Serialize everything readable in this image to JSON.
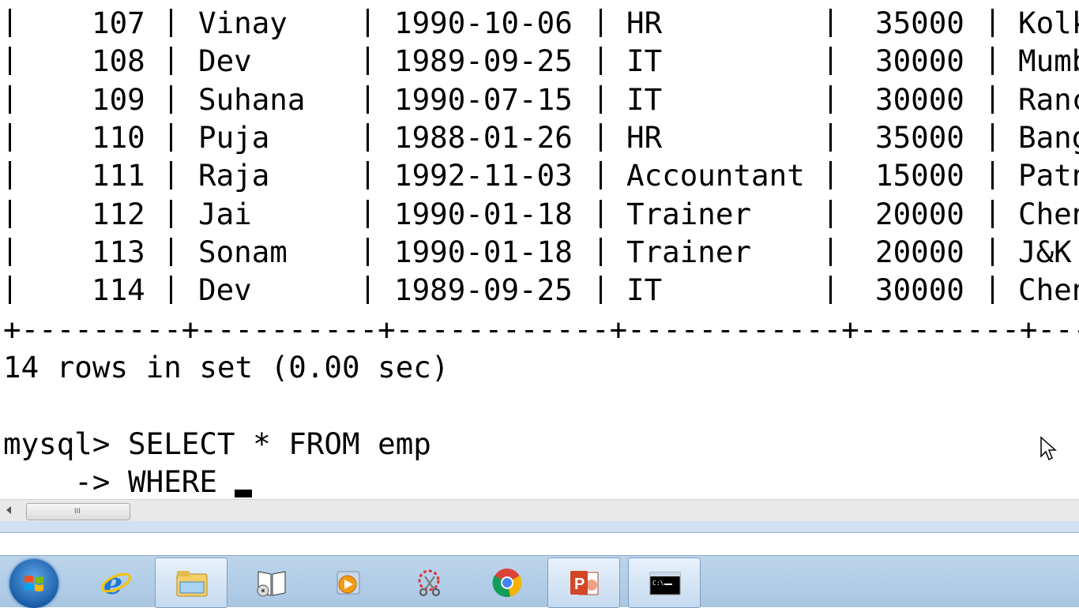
{
  "terminal": {
    "rows": [
      {
        "id": "107",
        "name": "Vinay",
        "dob": "1990-10-06",
        "dept": "HR",
        "salary": "35000",
        "city": "Kolk"
      },
      {
        "id": "108",
        "name": "Dev",
        "dob": "1989-09-25",
        "dept": "IT",
        "salary": "30000",
        "city": "Mumb"
      },
      {
        "id": "109",
        "name": "Suhana",
        "dob": "1990-07-15",
        "dept": "IT",
        "salary": "30000",
        "city": "Ranc"
      },
      {
        "id": "110",
        "name": "Puja",
        "dob": "1988-01-26",
        "dept": "HR",
        "salary": "35000",
        "city": "Bang"
      },
      {
        "id": "111",
        "name": "Raja",
        "dob": "1992-11-03",
        "dept": "Accountant",
        "salary": "15000",
        "city": "Patn"
      },
      {
        "id": "112",
        "name": "Jai",
        "dob": "1990-01-18",
        "dept": "Trainer",
        "salary": "20000",
        "city": "Chen"
      },
      {
        "id": "113",
        "name": "Sonam",
        "dob": "1990-01-18",
        "dept": "Trainer",
        "salary": "20000",
        "city": "J&K "
      },
      {
        "id": "114",
        "name": "Dev",
        "dob": "1989-09-25",
        "dept": "IT",
        "salary": "30000",
        "city": "Chen"
      }
    ],
    "separator": "+---------+----------+------------+------------+---------+-----",
    "result_text": "14 rows in set (0.00 sec)",
    "prompt_line": "mysql> SELECT * FROM emp",
    "continuation_line": "    -> WHERE "
  },
  "scrollbar": {
    "grip": "III"
  },
  "taskbar": {
    "items": [
      {
        "icon": "ie-icon"
      },
      {
        "icon": "explorer-folder-icon"
      },
      {
        "icon": "reader-book-icon"
      },
      {
        "icon": "media-player-icon"
      },
      {
        "icon": "snipping-tool-icon"
      },
      {
        "icon": "chrome-icon"
      },
      {
        "icon": "powerpoint-icon"
      },
      {
        "icon": "cmd-icon"
      }
    ],
    "colors": {
      "bar": "#b4cfe8",
      "active": "#d8e7f7"
    }
  }
}
